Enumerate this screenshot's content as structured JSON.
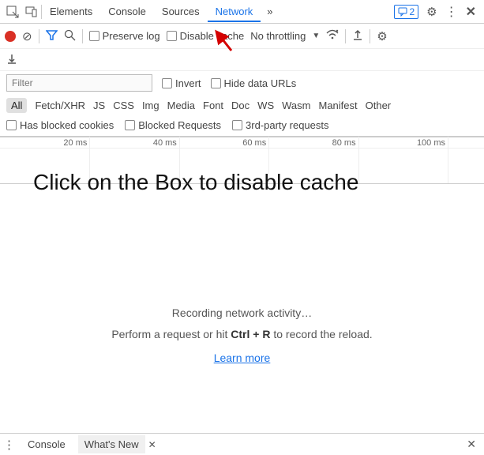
{
  "topTabs": {
    "items": [
      "Elements",
      "Console",
      "Sources",
      "Network"
    ],
    "activeIndex": 3,
    "more": "»",
    "msgCount": "2"
  },
  "toolbar": {
    "preserveLog": "Preserve log",
    "disableCache": "Disable cache",
    "throttle": "No throttling"
  },
  "filterRow": {
    "placeholder": "Filter",
    "invert": "Invert",
    "hideDataUrls": "Hide data URLs"
  },
  "types": [
    "All",
    "Fetch/XHR",
    "JS",
    "CSS",
    "Img",
    "Media",
    "Font",
    "Doc",
    "WS",
    "Wasm",
    "Manifest",
    "Other"
  ],
  "typesActiveIndex": 0,
  "moreFilters": {
    "blockedCookies": "Has blocked cookies",
    "blockedRequests": "Blocked Requests",
    "thirdParty": "3rd-party requests"
  },
  "timeline": {
    "ticks": [
      "20 ms",
      "40 ms",
      "60 ms",
      "80 ms",
      "100 ms"
    ]
  },
  "annotation": "Click on the Box to disable cache",
  "main": {
    "title": "Recording network activity…",
    "sub_pre": "Perform a request or hit ",
    "sub_key": "Ctrl + R",
    "sub_post": " to record the reload.",
    "learn": "Learn more"
  },
  "bottom": {
    "console": "Console",
    "whatsnew": "What's New"
  }
}
